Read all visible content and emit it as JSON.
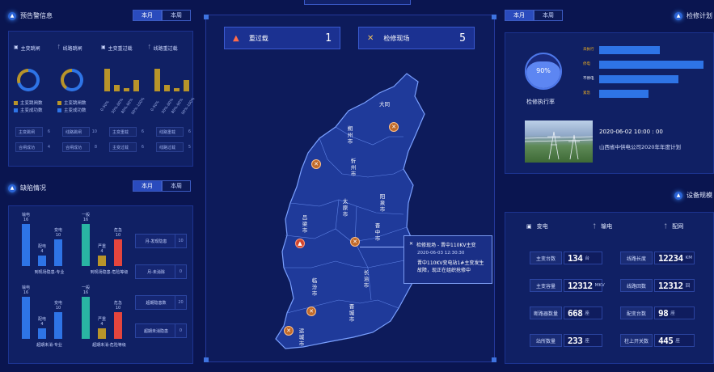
{
  "colors": {
    "bg": "#0a1550",
    "panel": "#102064",
    "blue": "#2e74e6",
    "gold": "#b8942a",
    "teal": "#29b5a3",
    "red": "#e4453d"
  },
  "alert": {
    "title": "预告警信息",
    "tabs": [
      "本月",
      "本周"
    ],
    "categories": [
      "主变跳闸",
      "线路跳闸",
      "主变重过载",
      "线路重过载"
    ],
    "legend": [
      "主变跳闸数",
      "主变成功数"
    ],
    "axis_labels": [
      "0-50%",
      "50%-80%",
      "80%-90%",
      "90%-100%"
    ],
    "grid": [
      {
        "label": "主变跳闸",
        "value": "6"
      },
      {
        "label": "线路跳闸",
        "value": "10"
      },
      {
        "label": "主变重载",
        "value": "6"
      },
      {
        "label": "线路重载",
        "value": "6"
      },
      {
        "label": "合闸成功",
        "value": "4"
      },
      {
        "label": "合闸成功",
        "value": "8"
      },
      {
        "label": "主变过载",
        "value": "6"
      },
      {
        "label": "线路过载",
        "value": "5"
      }
    ]
  },
  "defect": {
    "title": "缺陷情况",
    "tabs": [
      "本月",
      "本周"
    ],
    "chart_data": [
      {
        "type": "bar",
        "categories": [
          "输电",
          "配电",
          "变电"
        ],
        "values": [
          16,
          4,
          10
        ],
        "xlabel": "到现场隐患-专业"
      },
      {
        "type": "bar",
        "categories": [
          "一般",
          "严重",
          "危急"
        ],
        "values": [
          16,
          4,
          10
        ],
        "xlabel": "到现场隐患-危险等级"
      },
      {
        "type": "bar",
        "categories": [
          "输电",
          "配电",
          "变电"
        ],
        "values": [
          16,
          4,
          10
        ],
        "xlabel": "超期未消-专业"
      },
      {
        "type": "bar",
        "categories": [
          "一般",
          "严重",
          "危急"
        ],
        "values": [
          16,
          4,
          10
        ],
        "xlabel": "超期未消-危险等级"
      }
    ],
    "side": [
      {
        "label": "月-发现隐患",
        "value": "10"
      },
      {
        "label": "月-未消除",
        "value": "0"
      },
      {
        "label": "超期隐患数",
        "value": "20"
      },
      {
        "label": "超期未消隐患",
        "value": "0"
      }
    ]
  },
  "center": {
    "overload": {
      "label": "重过载",
      "count": "1"
    },
    "onsite": {
      "label": "检修现场",
      "count": "5"
    },
    "cities": [
      "大同",
      "朔州市",
      "忻州市",
      "阳泉市",
      "太原市",
      "吕梁市",
      "晋中市",
      "临汾市",
      "长治市",
      "晋城市",
      "运城市"
    ],
    "popup": {
      "title": "检修现场 - 晋中110KV主变",
      "time": "2020-06-03 12:30:30",
      "desc": "晋中110KV变电站1#主变发生故障，现正在组织抢修中"
    }
  },
  "plan": {
    "title": "检修计划",
    "tabs": [
      "本月",
      "本周"
    ],
    "rate_label": "检修执行率",
    "rate": "90%",
    "chart_data": {
      "type": "bar",
      "categories": [
        "未执行",
        "停电",
        "不停电",
        "紧急"
      ],
      "values": [
        0.55,
        0.95,
        0.72,
        0.45
      ]
    },
    "event_time": "2020-06-02 10:00 : 00",
    "event_desc": "山西省中供电公司2020年年度计划"
  },
  "device": {
    "title": "设备规模",
    "types": [
      "变电",
      "输电",
      "配网"
    ],
    "stats": [
      {
        "label": "主变台数",
        "value": "134",
        "unit": "台"
      },
      {
        "label": "线路长度",
        "value": "12234",
        "unit": "KM"
      },
      {
        "label": "主变容量",
        "value": "12312",
        "unit": "MKV"
      },
      {
        "label": "线路回数",
        "value": "12312",
        "unit": "回"
      },
      {
        "label": "断路器数量",
        "value": "668",
        "unit": "座"
      },
      {
        "label": "配变台数",
        "value": "98",
        "unit": "座"
      },
      {
        "label": "站所数量",
        "value": "233",
        "unit": "座"
      },
      {
        "label": "柱上开关数",
        "value": "445",
        "unit": "座"
      }
    ]
  }
}
